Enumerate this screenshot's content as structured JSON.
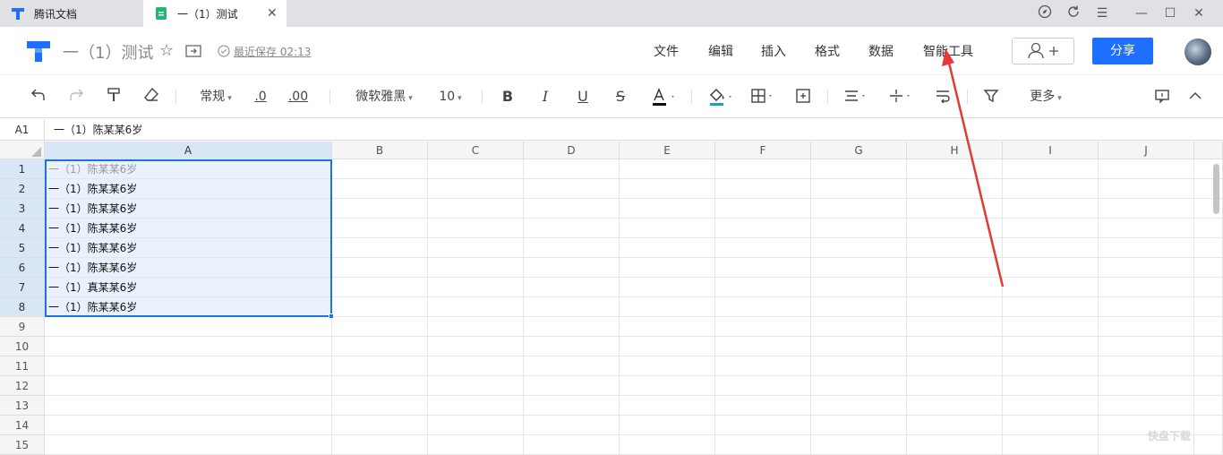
{
  "tabs": [
    {
      "label": "腾讯文档"
    },
    {
      "label": "一（1）测试"
    }
  ],
  "header": {
    "title": "一（1）测试",
    "save_status": "最近保存 02:13",
    "menus": [
      "文件",
      "编辑",
      "插入",
      "格式",
      "数据",
      "智能工具"
    ],
    "share_label": "分享"
  },
  "toolbar": {
    "number_format": "常规",
    "decrease_decimal": ".0",
    "increase_decimal": ".00",
    "font_family": "微软雅黑",
    "font_size": "10",
    "more_label": "更多"
  },
  "formula_bar": {
    "cell_ref": "A1",
    "content": "一（1）陈某某6岁"
  },
  "grid": {
    "columns": [
      "A",
      "B",
      "C",
      "D",
      "E",
      "F",
      "G",
      "H",
      "I",
      "J"
    ],
    "rows": [
      "1",
      "2",
      "3",
      "4",
      "5",
      "6",
      "7",
      "8",
      "9",
      "10",
      "11",
      "12",
      "13",
      "14",
      "15"
    ],
    "colA_values": [
      "一（1）陈某某6岁",
      "一（1）陈某某6岁",
      "一（1）陈某某6岁",
      "一（1）陈某某6岁",
      "一（1）陈某某6岁",
      "一（1）陈某某6岁",
      "一（1）真某某6岁",
      "一（1）陈某某6岁"
    ]
  },
  "colors": {
    "accent": "#1e6fff",
    "selection": "#1a73e8",
    "annotation_arrow": "#e53935"
  }
}
